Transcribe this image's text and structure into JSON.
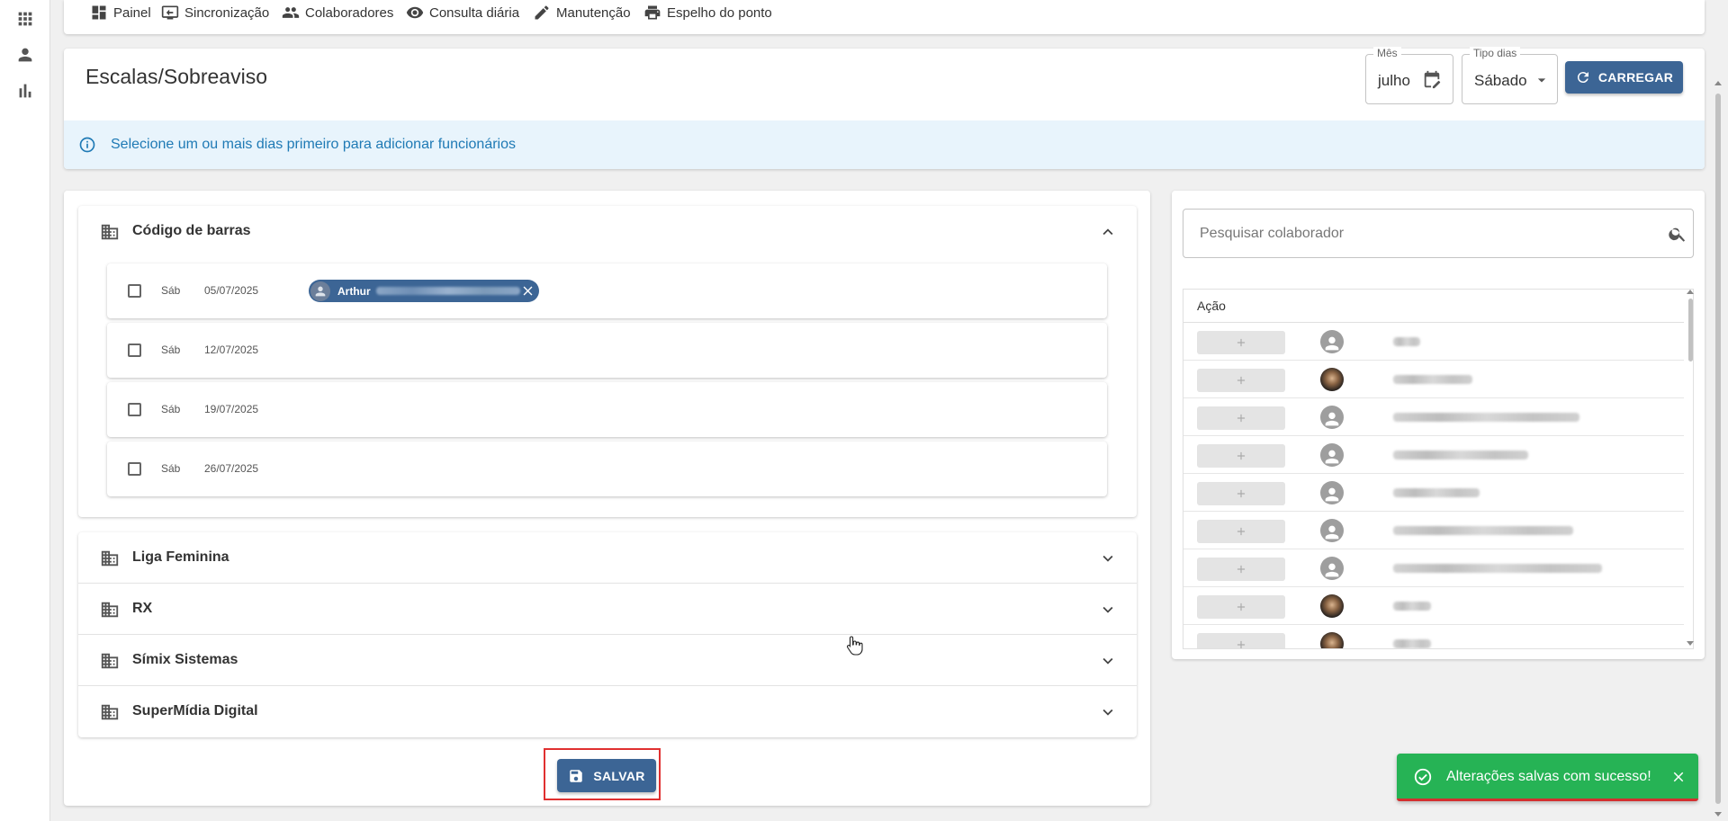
{
  "nav": {
    "items": [
      "Painel",
      "Sincronização",
      "Colaboradores",
      "Consulta diária",
      "Manutenção",
      "Espelho do ponto"
    ]
  },
  "header": {
    "title": "Escalas/Sobreaviso",
    "month_label": "Mês",
    "month_value": "julho",
    "daytype_label": "Tipo dias",
    "daytype_value": "Sábado",
    "load_button": "CARREGAR",
    "info_message": "Selecione um ou mais dias primeiro para adicionar funcionários"
  },
  "groups": [
    {
      "name": "Código de barras",
      "expanded": true,
      "days": [
        {
          "day": "Sáb",
          "date": "05/07/2025",
          "chip": "Arthur"
        },
        {
          "day": "Sáb",
          "date": "12/07/2025"
        },
        {
          "day": "Sáb",
          "date": "19/07/2025"
        },
        {
          "day": "Sáb",
          "date": "26/07/2025"
        }
      ]
    },
    {
      "name": "Liga Feminina",
      "expanded": false
    },
    {
      "name": "RX",
      "expanded": false
    },
    {
      "name": "Símix Sistemas",
      "expanded": false
    },
    {
      "name": "SuperMídia Digital",
      "expanded": false
    }
  ],
  "save_button": "SALVAR",
  "sidebar": {
    "search_placeholder": "Pesquisar colaborador",
    "column_header": "Ação"
  },
  "toast": {
    "message": "Alterações salvas com sucesso!",
    "color": "#26b355"
  },
  "colors": {
    "primary": "#3c6595",
    "info_text": "#1f7ab5",
    "info_bg": "#e8f4fc",
    "highlight": "#e03030"
  }
}
